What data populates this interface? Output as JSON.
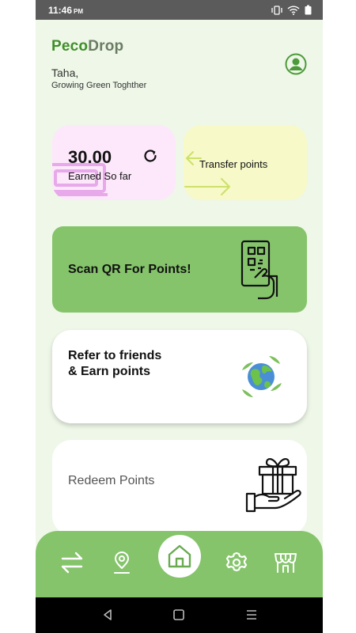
{
  "status_bar": {
    "time": "11:46",
    "ampm": "PM"
  },
  "header": {
    "brand_part1": "Peco",
    "brand_part2": "Drop",
    "greeting_name": "Taha,",
    "greeting_sub": "Growing Green Toghther"
  },
  "cards": {
    "earned": {
      "value": "30.00",
      "label": "Earned So far"
    },
    "transfer": {
      "label": "Transfer points"
    },
    "scan": {
      "label": "Scan QR For Points!"
    },
    "refer": {
      "label": "Refer to friends & Earn points"
    },
    "redeem": {
      "label": "Redeem Points"
    }
  },
  "nav": {
    "items": [
      "transfer-icon",
      "location-icon",
      "home-icon",
      "settings-icon",
      "store-icon"
    ],
    "active": "home-icon"
  },
  "colors": {
    "brand_green": "#3f8f2a",
    "nav_green": "#85c46b",
    "earned_card": "#fde8fb",
    "transfer_card": "#f7f9c8",
    "background": "#eef7e8"
  }
}
